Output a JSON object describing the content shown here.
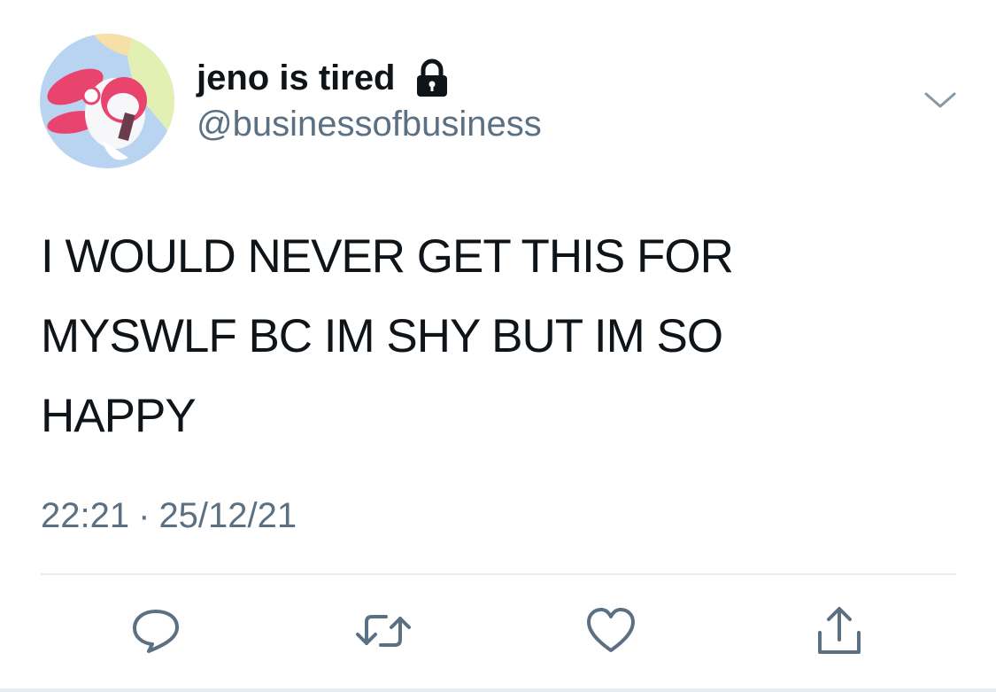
{
  "tweet": {
    "display_name": "jeno is tired",
    "handle": "@businessofbusiness",
    "text": "I WOULD NEVER GET THIS FOR\nMYSWLF BC IM SHY BUT IM SO\nHAPPY",
    "time": "22:21",
    "separator": "·",
    "date": "25/12/21",
    "protected": true
  },
  "icons": {
    "lock": "lock-icon",
    "more": "chevron-down-icon",
    "reply": "reply-icon",
    "retweet": "retweet-icon",
    "like": "heart-icon",
    "share": "share-icon"
  },
  "colors": {
    "text": "#0f1419",
    "secondary": "#5b7083",
    "divider": "#e6ecf0"
  }
}
